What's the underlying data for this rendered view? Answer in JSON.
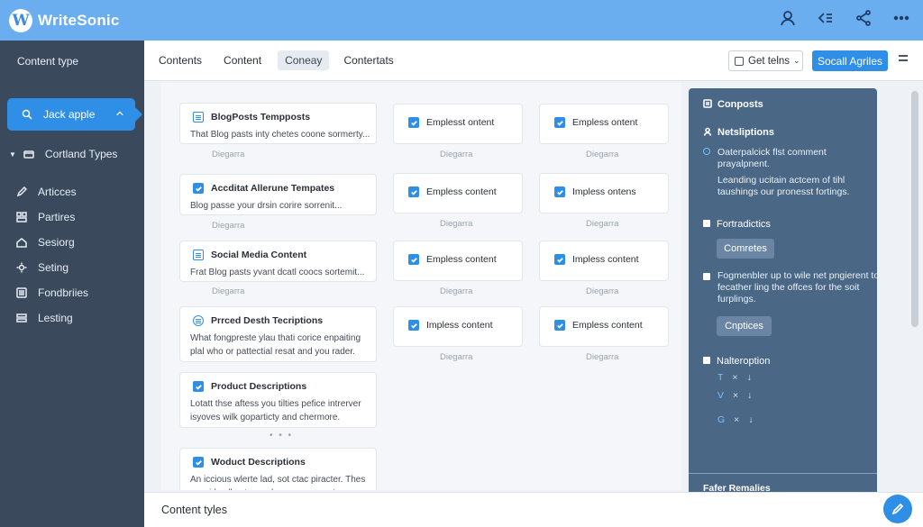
{
  "app": {
    "logo_letter": "W",
    "name": "WriteSonic"
  },
  "sidebar": {
    "header": "Content type",
    "active_item": "Jack apple",
    "group_label": "Cortland Types",
    "items": [
      "Articces",
      "Partires",
      "Sesiorg",
      "Seting",
      "Fondbriies",
      "Lesting"
    ]
  },
  "tabs": {
    "items": [
      "Contents",
      "Content",
      "Coneay",
      "Contertats"
    ],
    "selected_index": 2,
    "dropdown_label": "Get telns",
    "primary_button": "Socall Agriles"
  },
  "main": {
    "large_cards": [
      {
        "title": "BlogPosts Tempposts",
        "desc": "That Blog pasts inty chetes coone sormerty...",
        "caption": "Diegarra",
        "icon": "doc-icon"
      },
      {
        "title": "Accditat Allerune Tempates",
        "desc": "Blog passe your drsin corire sorrenit...",
        "caption": "Diegarra",
        "icon": "check-icon"
      },
      {
        "title": "Social Media Content",
        "desc": "Frat Blog pasts yvant dcatl coocs sortemit...",
        "caption": "Diegarra",
        "icon": "doc-icon"
      },
      {
        "title": "Prrced Desth Tecriptions",
        "desc": "What fongpreste ylau thati corice enpaiting plal who or pattectial resat and you rader.",
        "caption": "",
        "icon": "badge-icon"
      },
      {
        "title": "Product Descriptions",
        "desc": "Lotatt thse aftess you tilties pefice intrerver isyoves wilk goparticty and chermore.",
        "caption": "",
        "icon": "check-icon"
      },
      {
        "title": "Woduct Descriptions",
        "desc": "An iccious wlerte lad, sot ctac piracter. Thes sensirl call cutcmurch conce sornents...",
        "caption": "",
        "icon": "check-icon"
      }
    ],
    "small_cards": [
      {
        "label": "Emplesst ontent",
        "caption": "Diegarra"
      },
      {
        "label": "Empless ontent",
        "caption": "Diegarra"
      },
      {
        "label": "Empless content",
        "caption": "Diegarra"
      },
      {
        "label": "Impless ontens",
        "caption": "Diegarra"
      },
      {
        "label": "Empless content",
        "caption": "Diegarra"
      },
      {
        "label": "Impless content",
        "caption": "Diegarra"
      },
      {
        "label": "Impless content",
        "caption": "Diegarra"
      },
      {
        "label": "Empless content",
        "caption": "Diegarra"
      }
    ],
    "more_indicator": "• • •"
  },
  "right_panel": {
    "header": "Conposts",
    "subheader": "Netsliptions",
    "text1": "Oaterpalcick flst comment prayalpnent.",
    "text2": "Leanding ucitain actcem of tihl taushings our pronesst fortings.",
    "section1": "Fortradictics",
    "button1": "Comretes",
    "section2_text": "Fogmenbler up to wile net pngierent to fecather ling the offces for the soit furplings.",
    "button2": "Cnptices",
    "section3": "Nalteroption",
    "rows": [
      {
        "letter": "T",
        "x": "×",
        "arrow": "↓"
      },
      {
        "letter": "V",
        "x": "×",
        "arrow": "↓"
      },
      {
        "letter": "G",
        "x": "×",
        "arrow": "↓"
      }
    ],
    "footer": "Fafer Remalies"
  },
  "bottom": {
    "label": "Content tyles"
  }
}
